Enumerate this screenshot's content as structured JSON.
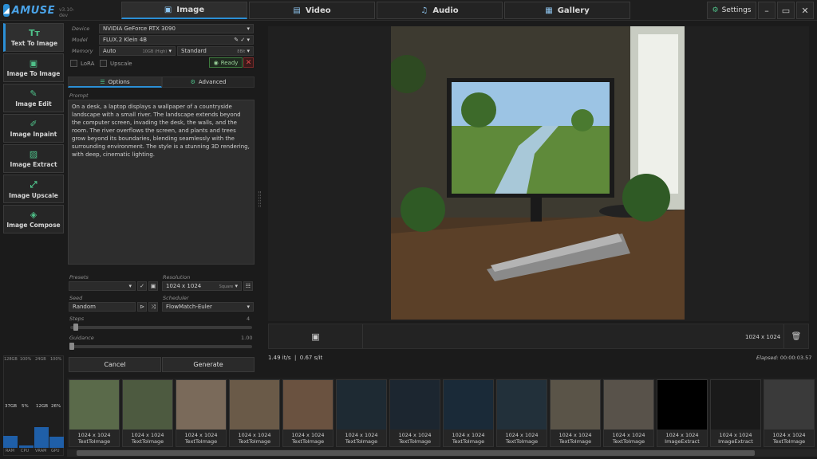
{
  "app": {
    "name": "AMUSE",
    "version": "v3.10-dev"
  },
  "tabs": [
    {
      "label": "Image",
      "icon": "image-icon",
      "active": true
    },
    {
      "label": "Video",
      "icon": "video-icon",
      "active": false
    },
    {
      "label": "Audio",
      "icon": "music-icon",
      "active": false
    },
    {
      "label": "Gallery",
      "icon": "gallery-icon",
      "active": false
    }
  ],
  "settings_label": "Settings",
  "nav": [
    {
      "label": "Text To Image",
      "active": true
    },
    {
      "label": "Image To Image"
    },
    {
      "label": "Image Edit"
    },
    {
      "label": "Image Inpaint"
    },
    {
      "label": "Image Extract"
    },
    {
      "label": "Image Upscale"
    },
    {
      "label": "Image Compose"
    }
  ],
  "device": {
    "label": "Device",
    "value": "NVIDIA GeForce RTX 3090"
  },
  "model": {
    "label": "Model",
    "value": "FLUX.2 Klein 4B"
  },
  "memory": {
    "label": "Memory",
    "value": "Auto",
    "vram": "10GB (High)",
    "mode": "Standard",
    "bits": "8Bit"
  },
  "lora_label": "LoRA",
  "upscale_label": "Upscale",
  "ready_label": "Ready",
  "subtabs": {
    "options": "Options",
    "advanced": "Advanced"
  },
  "prompt": {
    "label": "Prompt",
    "text": "On a desk, a laptop displays a wallpaper of a countryside landscape with a small river. The landscape extends beyond the computer screen, invading the desk, the walls, and the room. The river overflows the screen, and plants and trees grow beyond its boundaries, blending seamlessly with the surrounding environment. The style is a stunning 3D rendering, with deep, cinematic lighting."
  },
  "presets": {
    "label": "Presets",
    "value": ""
  },
  "resolution": {
    "label": "Resolution",
    "value": "1024 x 1024",
    "aspect": "Square"
  },
  "seed": {
    "label": "Seed",
    "value": "Random"
  },
  "scheduler": {
    "label": "Scheduler",
    "value": "FlowMatch-Euler"
  },
  "steps": {
    "label": "Steps",
    "value": "4"
  },
  "guidance": {
    "label": "Guidance",
    "value": "1.00"
  },
  "buttons": {
    "cancel": "Cancel",
    "generate": "Generate"
  },
  "stats": [
    {
      "label": "RAM",
      "top": "128GB",
      "value": "37GB",
      "level": 0.29
    },
    {
      "label": "CPU",
      "top": "100%",
      "value": "5%",
      "level": 0.05
    },
    {
      "label": "VRAM",
      "top": "24GB",
      "value": "12GB",
      "level": 0.5
    },
    {
      "label": "GPU",
      "top": "100%",
      "value": "26%",
      "level": 0.26
    }
  ],
  "preview": {
    "resolution": "1024 x 1024",
    "speed": "1.49 it/s",
    "rate": "0.67 s/it",
    "elapsed_label": "Elapsed:",
    "elapsed": "00:00:03.57"
  },
  "gallery": [
    {
      "size": "1024 x 1024",
      "type": "TextToImage",
      "color": "#5a6a4a"
    },
    {
      "size": "1024 x 1024",
      "type": "TextToImage",
      "color": "#4d5a40"
    },
    {
      "size": "1024 x 1024",
      "type": "TextToImage",
      "color": "#7a6a5a"
    },
    {
      "size": "1024 x 1024",
      "type": "TextToImage",
      "color": "#6a5a48"
    },
    {
      "size": "1024 x 1024",
      "type": "TextToImage",
      "color": "#6a5240"
    },
    {
      "size": "1024 x 1024",
      "type": "TextToImage",
      "color": "#1e2a33"
    },
    {
      "size": "1024 x 1024",
      "type": "TextToImage",
      "color": "#1c2630"
    },
    {
      "size": "1024 x 1024",
      "type": "TextToImage",
      "color": "#1a2a38"
    },
    {
      "size": "1024 x 1024",
      "type": "TextToImage",
      "color": "#22303a"
    },
    {
      "size": "1024 x 1024",
      "type": "TextToImage",
      "color": "#5a5448"
    },
    {
      "size": "1024 x 1024",
      "type": "TextToImage",
      "color": "#58524a"
    },
    {
      "size": "1024 x 1024",
      "type": "ImageExtract",
      "color": "#000000"
    },
    {
      "size": "1024 x 1024",
      "type": "ImageExtract",
      "color": "#1a1a1a"
    },
    {
      "size": "1024 x 1024",
      "type": "TextToImage",
      "color": "#3a3a3a"
    }
  ]
}
